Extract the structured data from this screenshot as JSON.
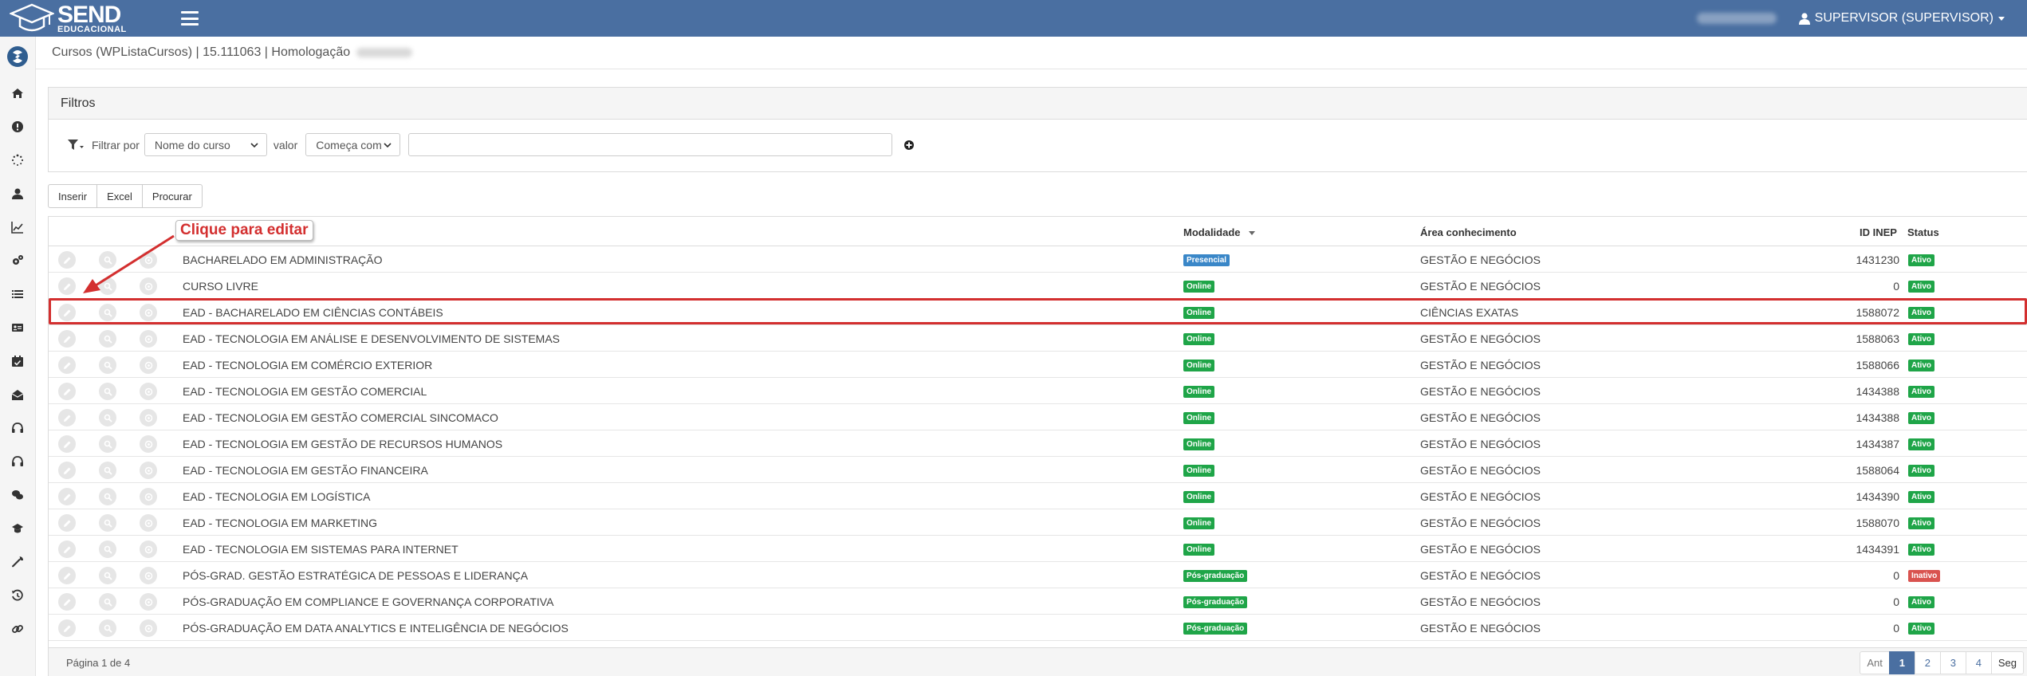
{
  "header": {
    "logo_title": "SEND",
    "logo_subtitle": "EDUCACIONAL",
    "user_label": "SUPERVISOR (SUPERVISOR)"
  },
  "breadcrumb": {
    "text": "Cursos (WPListaCursos) | 15.111063 | Homologação"
  },
  "filters": {
    "title": "Filtros",
    "filter_by_label": "Filtrar por",
    "field_select_value": "Nome do curso",
    "value_label": "valor",
    "operator_select_value": "Começa com",
    "search_value": ""
  },
  "toolbar": {
    "insert_label": "Inserir",
    "excel_label": "Excel",
    "search_label": "Procurar"
  },
  "table": {
    "columns": {
      "modalidade": "Modalidade",
      "area": "Área conhecimento",
      "id_inep": "ID INEP",
      "status": "Status"
    },
    "rows": [
      {
        "name": "BACHARELADO EM ADMINISTRAÇÃO",
        "modalidade": "Presencial",
        "area": "GESTÃO E NEGÓCIOS",
        "id_inep": "1431230",
        "status": "Ativo"
      },
      {
        "name": "CURSO LIVRE",
        "modalidade": "Online",
        "area": "GESTÃO E NEGÓCIOS",
        "id_inep": "0",
        "status": "Ativo"
      },
      {
        "name": "EAD - BACHARELADO EM CIÊNCIAS CONTÁBEIS",
        "modalidade": "Online",
        "area": "CIÊNCIAS EXATAS",
        "id_inep": "1588072",
        "status": "Ativo"
      },
      {
        "name": "EAD - TECNOLOGIA EM ANÁLISE E DESENVOLVIMENTO DE SISTEMAS",
        "modalidade": "Online",
        "area": "GESTÃO E NEGÓCIOS",
        "id_inep": "1588063",
        "status": "Ativo"
      },
      {
        "name": "EAD - TECNOLOGIA EM COMÉRCIO EXTERIOR",
        "modalidade": "Online",
        "area": "GESTÃO E NEGÓCIOS",
        "id_inep": "1588066",
        "status": "Ativo"
      },
      {
        "name": "EAD - TECNOLOGIA EM GESTÃO COMERCIAL",
        "modalidade": "Online",
        "area": "GESTÃO E NEGÓCIOS",
        "id_inep": "1434388",
        "status": "Ativo"
      },
      {
        "name": "EAD - TECNOLOGIA EM GESTÃO COMERCIAL SINCOMACO",
        "modalidade": "Online",
        "area": "GESTÃO E NEGÓCIOS",
        "id_inep": "1434388",
        "status": "Ativo"
      },
      {
        "name": "EAD - TECNOLOGIA EM GESTÃO DE RECURSOS HUMANOS",
        "modalidade": "Online",
        "area": "GESTÃO E NEGÓCIOS",
        "id_inep": "1434387",
        "status": "Ativo"
      },
      {
        "name": "EAD - TECNOLOGIA EM GESTÃO FINANCEIRA",
        "modalidade": "Online",
        "area": "GESTÃO E NEGÓCIOS",
        "id_inep": "1588064",
        "status": "Ativo"
      },
      {
        "name": "EAD - TECNOLOGIA EM LOGÍSTICA",
        "modalidade": "Online",
        "area": "GESTÃO E NEGÓCIOS",
        "id_inep": "1434390",
        "status": "Ativo"
      },
      {
        "name": "EAD - TECNOLOGIA EM MARKETING",
        "modalidade": "Online",
        "area": "GESTÃO E NEGÓCIOS",
        "id_inep": "1588070",
        "status": "Ativo"
      },
      {
        "name": "EAD - TECNOLOGIA EM SISTEMAS PARA INTERNET",
        "modalidade": "Online",
        "area": "GESTÃO E NEGÓCIOS",
        "id_inep": "1434391",
        "status": "Ativo"
      },
      {
        "name": "PÓS-GRAD. GESTÃO ESTRATÉGICA DE PESSOAS E LIDERANÇA",
        "modalidade": "Pós-graduação",
        "area": "GESTÃO E NEGÓCIOS",
        "id_inep": "0",
        "status": "Inativo"
      },
      {
        "name": "PÓS-GRADUAÇÃO EM COMPLIANCE E GOVERNANÇA CORPORATIVA",
        "modalidade": "Pós-graduação",
        "area": "GESTÃO E NEGÓCIOS",
        "id_inep": "0",
        "status": "Ativo"
      },
      {
        "name": "PÓS-GRADUAÇÃO EM DATA ANALYTICS E INTELIGÊNCIA DE NEGÓCIOS",
        "modalidade": "Pós-graduação",
        "area": "GESTÃO E NEGÓCIOS",
        "id_inep": "0",
        "status": "Ativo"
      }
    ]
  },
  "footer": {
    "page_info": "Página 1 de 4",
    "prev_label": "Ant",
    "pages": [
      "1",
      "2",
      "3",
      "4"
    ],
    "next_label": "Seg"
  },
  "annotation": {
    "callout_text": "Clique para editar"
  },
  "colors": {
    "topbar": "#4a6fa1",
    "online": "#1fa548",
    "presencial": "#3a87c8",
    "inativo": "#d9534f",
    "highlight": "#d32f2f"
  }
}
